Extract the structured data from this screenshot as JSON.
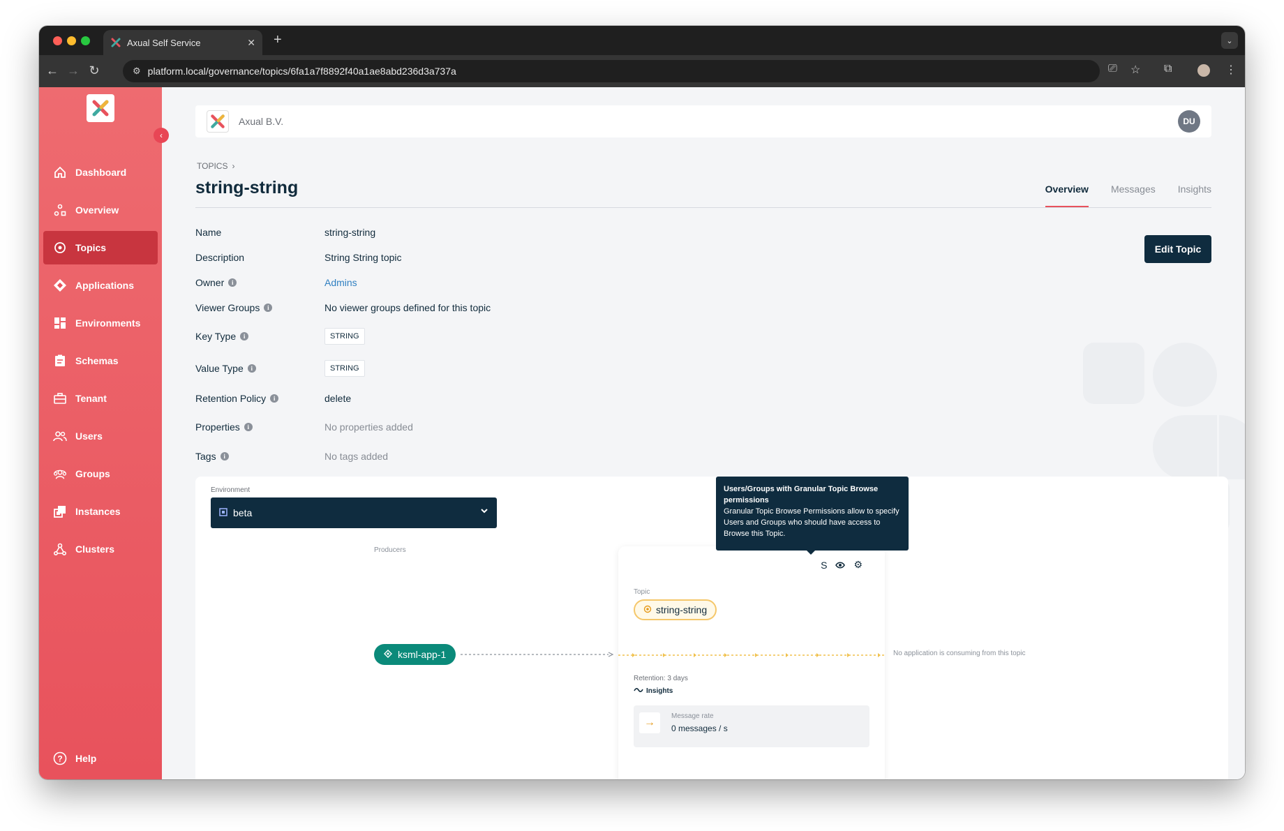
{
  "browser": {
    "tab_title": "Axual Self Service",
    "url": "platform.local/governance/topics/6fa1a7f8892f40a1ae8abd236d3a737a"
  },
  "sidebar": {
    "items": [
      {
        "label": "Dashboard",
        "icon": "home-icon"
      },
      {
        "label": "Overview",
        "icon": "overview-icon"
      },
      {
        "label": "Topics",
        "icon": "topic-icon",
        "active": true
      },
      {
        "label": "Applications",
        "icon": "applications-icon"
      },
      {
        "label": "Environments",
        "icon": "environments-icon"
      },
      {
        "label": "Schemas",
        "icon": "schemas-icon"
      },
      {
        "label": "Tenant",
        "icon": "tenant-icon"
      },
      {
        "label": "Users",
        "icon": "users-icon"
      },
      {
        "label": "Groups",
        "icon": "groups-icon"
      },
      {
        "label": "Instances",
        "icon": "instances-icon"
      },
      {
        "label": "Clusters",
        "icon": "clusters-icon"
      }
    ],
    "help_label": "Help"
  },
  "header": {
    "org_name": "Axual B.V.",
    "avatar_initials": "DU"
  },
  "breadcrumb": {
    "label": "TOPICS"
  },
  "page": {
    "title": "string-string",
    "tabs": [
      "Overview",
      "Messages",
      "Insights"
    ],
    "active_tab": "Overview",
    "edit_button": "Edit Topic"
  },
  "properties": {
    "name": {
      "label": "Name",
      "value": "string-string"
    },
    "description": {
      "label": "Description",
      "value": "String String topic"
    },
    "owner": {
      "label": "Owner",
      "value": "Admins"
    },
    "viewer_groups": {
      "label": "Viewer Groups",
      "value": "No viewer groups defined for this topic"
    },
    "key_type": {
      "label": "Key Type",
      "value": "STRING"
    },
    "value_type": {
      "label": "Value Type",
      "value": "STRING"
    },
    "retention_policy": {
      "label": "Retention Policy",
      "value": "delete"
    },
    "properties": {
      "label": "Properties",
      "value": "No properties added"
    },
    "tags": {
      "label": "Tags",
      "value": "No tags added"
    }
  },
  "environment": {
    "label": "Environment",
    "selected": "beta"
  },
  "flow": {
    "producers_label": "Producers",
    "producer_app": "ksml-app-1",
    "topic_label": "Topic",
    "topic_name": "string-string",
    "retention": "Retention: 3 days",
    "insights_link": "Insights",
    "message_rate_label": "Message rate",
    "message_rate_value": "0 messages / s",
    "no_consumers": "No application is consuming from this topic"
  },
  "tooltip": {
    "title": "Users/Groups with Granular Topic Browse permissions",
    "body": "Granular Topic Browse Permissions allow to specify Users and Groups who should have access to Browse this Topic."
  },
  "colors": {
    "sidebar": "#e8525c",
    "sidebar_active": "#c8353f",
    "primary_dark": "#0f2c3f",
    "producer_teal": "#0b8a7a",
    "topic_yellow": "#f5c76a"
  }
}
